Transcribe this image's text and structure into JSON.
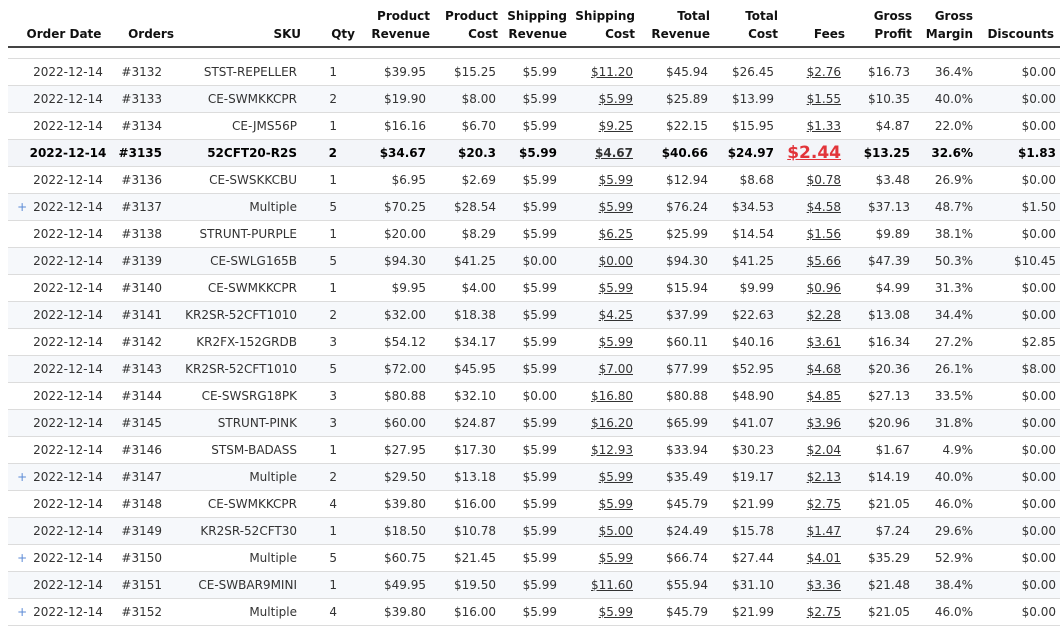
{
  "headers": [
    "Order Date",
    "Orders",
    "SKU",
    "Qty",
    "Product\nRevenue",
    "Product\nCost",
    "Shipping\nRevenue",
    "Shipping\nCost",
    "Total\nRevenue",
    "Total\nCost",
    "Fees",
    "Gross\nProfit",
    "Gross\nMargin",
    "Discounts"
  ],
  "colors": {
    "highlight_fee": "#e2343a",
    "expand_icon": "#5b8ad6",
    "row_alt": "#f6f8fb"
  },
  "expand_icon_glyph": "+",
  "rows": [
    {
      "date": "2022-12-14",
      "order": "#3132",
      "sku": "STST-REPELLER",
      "qty": "1",
      "prev": "$39.95",
      "pcost": "$15.25",
      "srev": "$5.99",
      "scost": "$11.20",
      "trev": "$45.94",
      "tcost": "$26.45",
      "fees": "$2.76",
      "gprofit": "$16.73",
      "gmargin": "36.4%",
      "disc": "$0.00",
      "expand": false,
      "bold": false
    },
    {
      "date": "2022-12-14",
      "order": "#3133",
      "sku": "CE-SWMKKCPR",
      "qty": "2",
      "prev": "$19.90",
      "pcost": "$8.00",
      "srev": "$5.99",
      "scost": "$5.99",
      "trev": "$25.89",
      "tcost": "$13.99",
      "fees": "$1.55",
      "gprofit": "$10.35",
      "gmargin": "40.0%",
      "disc": "$0.00",
      "expand": false,
      "bold": false
    },
    {
      "date": "2022-12-14",
      "order": "#3134",
      "sku": "CE-JMS56P",
      "qty": "1",
      "prev": "$16.16",
      "pcost": "$6.70",
      "srev": "$5.99",
      "scost": "$9.25",
      "trev": "$22.15",
      "tcost": "$15.95",
      "fees": "$1.33",
      "gprofit": "$4.87",
      "gmargin": "22.0%",
      "disc": "$0.00",
      "expand": false,
      "bold": false
    },
    {
      "date": "2022-12-14",
      "order": "#3135",
      "sku": "52CFT20-R2S",
      "qty": "2",
      "prev": "$34.67",
      "pcost": "$20.3",
      "srev": "$5.99",
      "scost": "$4.67",
      "trev": "$40.66",
      "tcost": "$24.97",
      "fees": "$2.44",
      "gprofit": "$13.25",
      "gmargin": "32.6%",
      "disc": "$1.83",
      "expand": false,
      "bold": true
    },
    {
      "date": "2022-12-14",
      "order": "#3136",
      "sku": "CE-SWSKKCBU",
      "qty": "1",
      "prev": "$6.95",
      "pcost": "$2.69",
      "srev": "$5.99",
      "scost": "$5.99",
      "trev": "$12.94",
      "tcost": "$8.68",
      "fees": "$0.78",
      "gprofit": "$3.48",
      "gmargin": "26.9%",
      "disc": "$0.00",
      "expand": false,
      "bold": false
    },
    {
      "date": "2022-12-14",
      "order": "#3137",
      "sku": "Multiple",
      "qty": "5",
      "prev": "$70.25",
      "pcost": "$28.54",
      "srev": "$5.99",
      "scost": "$5.99",
      "trev": "$76.24",
      "tcost": "$34.53",
      "fees": "$4.58",
      "gprofit": "$37.13",
      "gmargin": "48.7%",
      "disc": "$1.50",
      "expand": true,
      "bold": false
    },
    {
      "date": "2022-12-14",
      "order": "#3138",
      "sku": "STRUNT-PURPLE",
      "qty": "1",
      "prev": "$20.00",
      "pcost": "$8.29",
      "srev": "$5.99",
      "scost": "$6.25",
      "trev": "$25.99",
      "tcost": "$14.54",
      "fees": "$1.56",
      "gprofit": "$9.89",
      "gmargin": "38.1%",
      "disc": "$0.00",
      "expand": false,
      "bold": false
    },
    {
      "date": "2022-12-14",
      "order": "#3139",
      "sku": "CE-SWLG165B",
      "qty": "5",
      "prev": "$94.30",
      "pcost": "$41.25",
      "srev": "$0.00",
      "scost": "$0.00",
      "trev": "$94.30",
      "tcost": "$41.25",
      "fees": "$5.66",
      "gprofit": "$47.39",
      "gmargin": "50.3%",
      "disc": "$10.45",
      "expand": false,
      "bold": false
    },
    {
      "date": "2022-12-14",
      "order": "#3140",
      "sku": "CE-SWMKKCPR",
      "qty": "1",
      "prev": "$9.95",
      "pcost": "$4.00",
      "srev": "$5.99",
      "scost": "$5.99",
      "trev": "$15.94",
      "tcost": "$9.99",
      "fees": "$0.96",
      "gprofit": "$4.99",
      "gmargin": "31.3%",
      "disc": "$0.00",
      "expand": false,
      "bold": false
    },
    {
      "date": "2022-12-14",
      "order": "#3141",
      "sku": "KR2SR-52CFT1010",
      "qty": "2",
      "prev": "$32.00",
      "pcost": "$18.38",
      "srev": "$5.99",
      "scost": "$4.25",
      "trev": "$37.99",
      "tcost": "$22.63",
      "fees": "$2.28",
      "gprofit": "$13.08",
      "gmargin": "34.4%",
      "disc": "$0.00",
      "expand": false,
      "bold": false
    },
    {
      "date": "2022-12-14",
      "order": "#3142",
      "sku": "KR2FX-152GRDB",
      "qty": "3",
      "prev": "$54.12",
      "pcost": "$34.17",
      "srev": "$5.99",
      "scost": "$5.99",
      "trev": "$60.11",
      "tcost": "$40.16",
      "fees": "$3.61",
      "gprofit": "$16.34",
      "gmargin": "27.2%",
      "disc": "$2.85",
      "expand": false,
      "bold": false
    },
    {
      "date": "2022-12-14",
      "order": "#3143",
      "sku": "KR2SR-52CFT1010",
      "qty": "5",
      "prev": "$72.00",
      "pcost": "$45.95",
      "srev": "$5.99",
      "scost": "$7.00",
      "trev": "$77.99",
      "tcost": "$52.95",
      "fees": "$4.68",
      "gprofit": "$20.36",
      "gmargin": "26.1%",
      "disc": "$8.00",
      "expand": false,
      "bold": false
    },
    {
      "date": "2022-12-14",
      "order": "#3144",
      "sku": "CE-SWSRG18PK",
      "qty": "3",
      "prev": "$80.88",
      "pcost": "$32.10",
      "srev": "$0.00",
      "scost": "$16.80",
      "trev": "$80.88",
      "tcost": "$48.90",
      "fees": "$4.85",
      "gprofit": "$27.13",
      "gmargin": "33.5%",
      "disc": "$0.00",
      "expand": false,
      "bold": false
    },
    {
      "date": "2022-12-14",
      "order": "#3145",
      "sku": "STRUNT-PINK",
      "qty": "3",
      "prev": "$60.00",
      "pcost": "$24.87",
      "srev": "$5.99",
      "scost": "$16.20",
      "trev": "$65.99",
      "tcost": "$41.07",
      "fees": "$3.96",
      "gprofit": "$20.96",
      "gmargin": "31.8%",
      "disc": "$0.00",
      "expand": false,
      "bold": false
    },
    {
      "date": "2022-12-14",
      "order": "#3146",
      "sku": "STSM-BADASS",
      "qty": "1",
      "prev": "$27.95",
      "pcost": "$17.30",
      "srev": "$5.99",
      "scost": "$12.93",
      "trev": "$33.94",
      "tcost": "$30.23",
      "fees": "$2.04",
      "gprofit": "$1.67",
      "gmargin": "4.9%",
      "disc": "$0.00",
      "expand": false,
      "bold": false
    },
    {
      "date": "2022-12-14",
      "order": "#3147",
      "sku": "Multiple",
      "qty": "2",
      "prev": "$29.50",
      "pcost": "$13.18",
      "srev": "$5.99",
      "scost": "$5.99",
      "trev": "$35.49",
      "tcost": "$19.17",
      "fees": "$2.13",
      "gprofit": "$14.19",
      "gmargin": "40.0%",
      "disc": "$0.00",
      "expand": true,
      "bold": false
    },
    {
      "date": "2022-12-14",
      "order": "#3148",
      "sku": "CE-SWMKKCPR",
      "qty": "4",
      "prev": "$39.80",
      "pcost": "$16.00",
      "srev": "$5.99",
      "scost": "$5.99",
      "trev": "$45.79",
      "tcost": "$21.99",
      "fees": "$2.75",
      "gprofit": "$21.05",
      "gmargin": "46.0%",
      "disc": "$0.00",
      "expand": false,
      "bold": false
    },
    {
      "date": "2022-12-14",
      "order": "#3149",
      "sku": "KR2SR-52CFT30",
      "qty": "1",
      "prev": "$18.50",
      "pcost": "$10.78",
      "srev": "$5.99",
      "scost": "$5.00",
      "trev": "$24.49",
      "tcost": "$15.78",
      "fees": "$1.47",
      "gprofit": "$7.24",
      "gmargin": "29.6%",
      "disc": "$0.00",
      "expand": false,
      "bold": false
    },
    {
      "date": "2022-12-14",
      "order": "#3150",
      "sku": "Multiple",
      "qty": "5",
      "prev": "$60.75",
      "pcost": "$21.45",
      "srev": "$5.99",
      "scost": "$5.99",
      "trev": "$66.74",
      "tcost": "$27.44",
      "fees": "$4.01",
      "gprofit": "$35.29",
      "gmargin": "52.9%",
      "disc": "$0.00",
      "expand": true,
      "bold": false
    },
    {
      "date": "2022-12-14",
      "order": "#3151",
      "sku": "CE-SWBAR9MINI",
      "qty": "1",
      "prev": "$49.95",
      "pcost": "$19.50",
      "srev": "$5.99",
      "scost": "$11.60",
      "trev": "$55.94",
      "tcost": "$31.10",
      "fees": "$3.36",
      "gprofit": "$21.48",
      "gmargin": "38.4%",
      "disc": "$0.00",
      "expand": false,
      "bold": false
    },
    {
      "date": "2022-12-14",
      "order": "#3152",
      "sku": "Multiple",
      "qty": "4",
      "prev": "$39.80",
      "pcost": "$16.00",
      "srev": "$5.99",
      "scost": "$5.99",
      "trev": "$45.79",
      "tcost": "$21.99",
      "fees": "$2.75",
      "gprofit": "$21.05",
      "gmargin": "46.0%",
      "disc": "$0.00",
      "expand": true,
      "bold": false
    }
  ]
}
